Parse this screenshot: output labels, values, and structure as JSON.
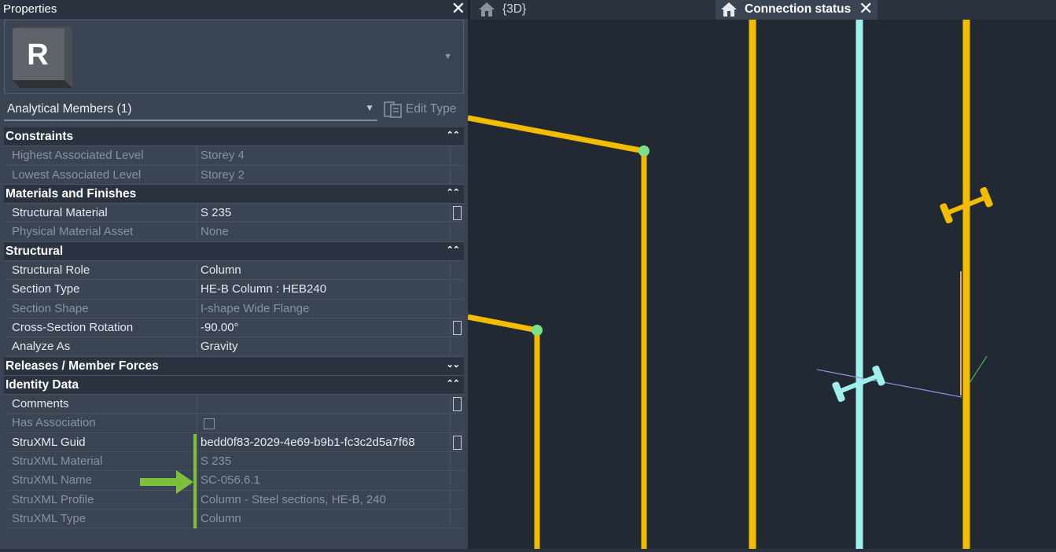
{
  "properties": {
    "title": "Properties",
    "logo_letter": "R",
    "filter_label": "Analytical Members (1)",
    "edit_type_label": "Edit Type",
    "groups": [
      {
        "name": "Constraints",
        "rows": [
          {
            "key": "Highest Associated Level",
            "value": "Storey 4",
            "dim": true
          },
          {
            "key": "Lowest Associated Level",
            "value": "Storey 2",
            "dim": true
          }
        ]
      },
      {
        "name": "Materials and Finishes",
        "rows": [
          {
            "key": "Structural Material",
            "value": "S 235",
            "dim": false
          },
          {
            "key": "Physical Material Asset",
            "value": "None",
            "dim": true
          }
        ]
      },
      {
        "name": "Structural",
        "rows": [
          {
            "key": "Structural Role",
            "value": "Column",
            "dim": false
          },
          {
            "key": "Section Type",
            "value": "HE-B Column : HEB240",
            "dim": false
          },
          {
            "key": "Section Shape",
            "value": "I-shape Wide Flange",
            "dim": true
          },
          {
            "key": "Cross-Section Rotation",
            "value": "-90.00°",
            "dim": false
          },
          {
            "key": "Analyze As",
            "value": "Gravity",
            "dim": false
          }
        ]
      },
      {
        "name": "Releases / Member Forces",
        "rows": []
      },
      {
        "name": "Identity Data",
        "rows": [
          {
            "key": "Comments",
            "value": "",
            "dim": false
          },
          {
            "key": "Has Association",
            "value": "",
            "dim": true
          },
          {
            "key": "StruXML Guid",
            "value": "bedd0f83-2029-4e69-b9b1-fc3c2d5a7f68",
            "dim": false
          },
          {
            "key": "StruXML Material",
            "value": "S 235",
            "dim": true
          },
          {
            "key": "StruXML Name",
            "value": "SC-056.6.1",
            "dim": true
          },
          {
            "key": "StruXML Profile",
            "value": "Column - Steel sections, HE-B, 240",
            "dim": true
          },
          {
            "key": "StruXML Type",
            "value": "Column",
            "dim": true
          }
        ]
      }
    ]
  },
  "tabs": [
    {
      "label": "{3D}",
      "active": false
    },
    {
      "label": "Connection status",
      "active": true
    }
  ],
  "colors": {
    "member": "#f2bd00",
    "selected_member": "#9ff0ec",
    "node": "#7fe08a",
    "annotation": "#7dbe3c"
  }
}
